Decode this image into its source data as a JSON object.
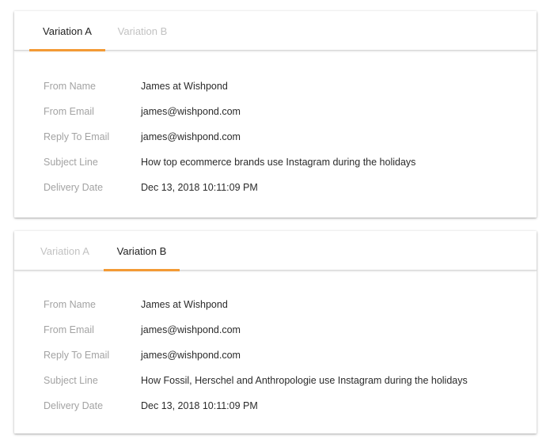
{
  "variations": [
    {
      "tabs": [
        {
          "label": "Variation A",
          "active": true
        },
        {
          "label": "Variation B",
          "active": false
        }
      ],
      "fields": [
        {
          "label": "From Name",
          "value": "James at Wishpond"
        },
        {
          "label": "From Email",
          "value": "james@wishpond.com"
        },
        {
          "label": "Reply To Email",
          "value": "james@wishpond.com"
        },
        {
          "label": "Subject Line",
          "value": "How top ecommerce brands use Instagram during the holidays"
        },
        {
          "label": "Delivery Date",
          "value": "Dec 13, 2018 10:11:09 PM"
        }
      ]
    },
    {
      "tabs": [
        {
          "label": "Variation A",
          "active": false
        },
        {
          "label": "Variation B",
          "active": true
        }
      ],
      "fields": [
        {
          "label": "From Name",
          "value": "James at Wishpond"
        },
        {
          "label": "From Email",
          "value": "james@wishpond.com"
        },
        {
          "label": "Reply To Email",
          "value": "james@wishpond.com"
        },
        {
          "label": "Subject Line",
          "value": "How Fossil, Herschel and Anthropologie use Instagram during the holidays"
        },
        {
          "label": "Delivery Date",
          "value": "Dec 13, 2018 10:11:09 PM"
        }
      ]
    }
  ],
  "accent_color": "#f39a35"
}
